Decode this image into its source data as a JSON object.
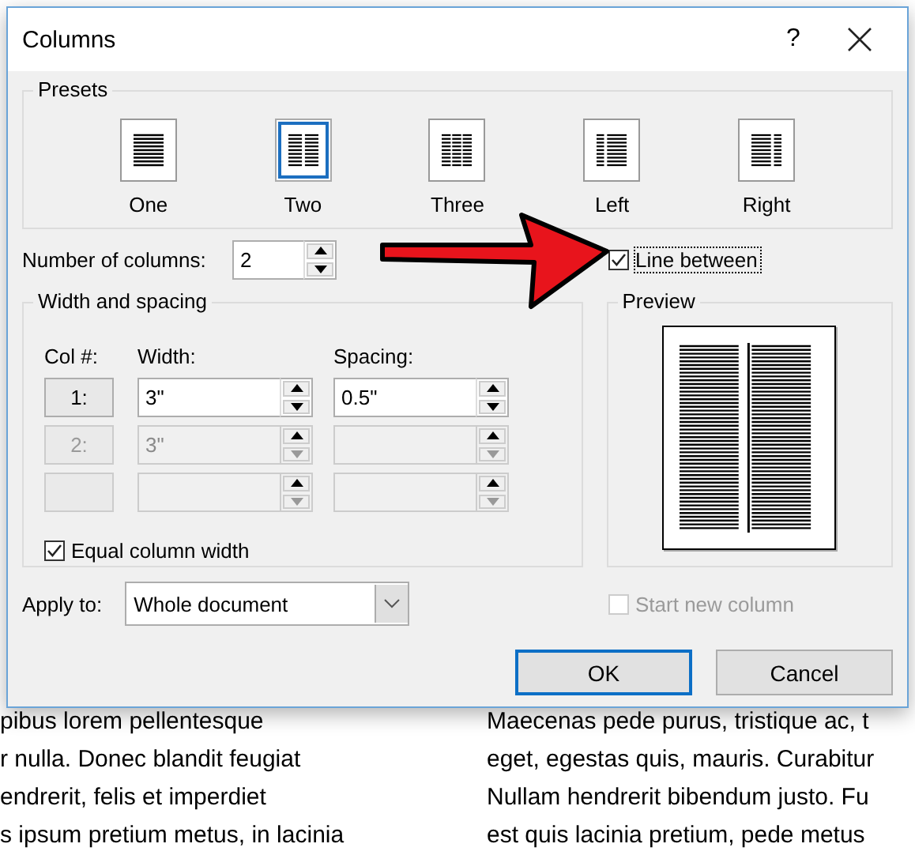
{
  "window": {
    "title": "Columns",
    "help": "?"
  },
  "presets": {
    "title": "Presets",
    "items": [
      {
        "label": "One",
        "kind": "one",
        "selected": false
      },
      {
        "label": "Two",
        "kind": "two",
        "selected": true
      },
      {
        "label": "Three",
        "kind": "three",
        "selected": false
      },
      {
        "label": "Left",
        "kind": "left",
        "selected": false
      },
      {
        "label": "Right",
        "kind": "right",
        "selected": false
      }
    ]
  },
  "number_of_columns": {
    "label": "Number of columns:",
    "value": "2"
  },
  "line_between": {
    "label": "Line between",
    "checked": true,
    "focused": true
  },
  "width_and_spacing": {
    "title": "Width and spacing",
    "headers": {
      "col": "Col #:",
      "width": "Width:",
      "spacing": "Spacing:"
    },
    "rows": [
      {
        "col": "1:",
        "width": "3\"",
        "spacing": "0.5\"",
        "disabled": false
      },
      {
        "col": "2:",
        "width": "3\"",
        "disabled": true
      },
      {
        "disabled": true
      }
    ]
  },
  "equal_column_width": {
    "label": "Equal column width",
    "checked": true
  },
  "preview": {
    "title": "Preview"
  },
  "apply_to": {
    "label": "Apply to:",
    "value": "Whole document"
  },
  "start_new_column": {
    "label": "Start new column",
    "checked": false,
    "disabled": true
  },
  "buttons": [
    {
      "label": "OK",
      "default": true
    },
    {
      "label": "Cancel",
      "default": false
    }
  ],
  "background_document": {
    "left_lines": [
      "pibus lorem pellentesque",
      "r nulla. Donec blandit feugiat",
      "endrerit, felis et imperdiet",
      "s ipsum pretium metus, in lacinia"
    ],
    "right_lines": [
      "Maecenas pede purus, tristique ac, t",
      "eget, egestas quis, mauris. Curabitur",
      "Nullam hendrerit bibendum justo. Fu",
      "est quis lacinia pretium, pede metus"
    ]
  }
}
